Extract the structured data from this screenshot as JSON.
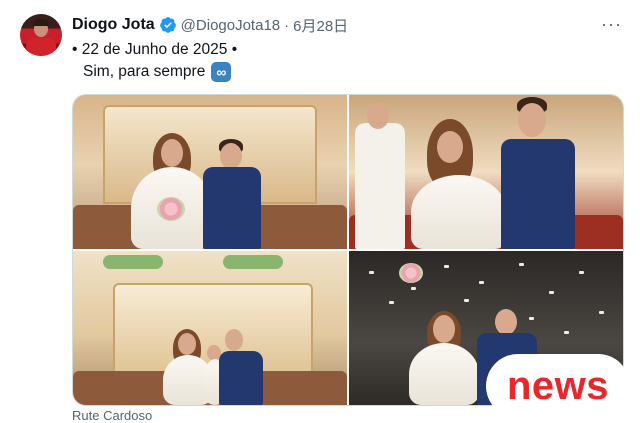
{
  "tweet": {
    "author_name": "Diogo Jota",
    "handle": "@DiogoJota18",
    "separator": "·",
    "date": "6月28日",
    "more_label": "···",
    "line1": "• 22 de Junho de 2025 •",
    "line2": "Sim, para sempre",
    "infinity_symbol": "∞"
  },
  "media": {
    "photos": [
      {
        "description": "wedding-couple-at-altar"
      },
      {
        "description": "couple-showing-rings"
      },
      {
        "description": "couple-with-child-at-altar"
      },
      {
        "description": "couple-exiting-with-confetti"
      }
    ],
    "credit": "Rute Cardoso"
  },
  "overlay": {
    "badge_text": "news",
    "badge_color": "#e8262b"
  },
  "colors": {
    "verified": "#1d9bf0",
    "secondary_text": "#536471",
    "primary_text": "#0f1419"
  }
}
